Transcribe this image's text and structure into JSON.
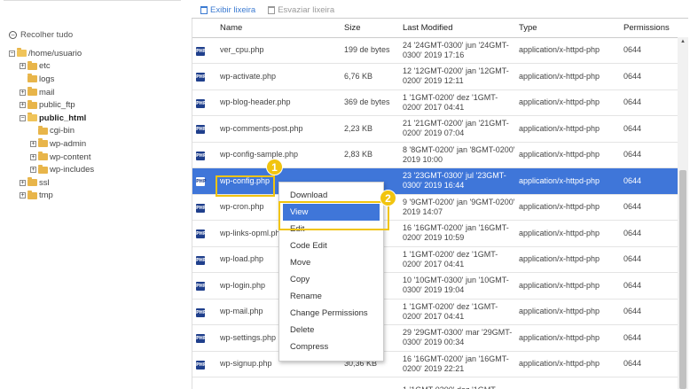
{
  "sidebar": {
    "collapse_label": "Recolher tudo",
    "tree": {
      "root": "/home/usuario",
      "etc": "etc",
      "logs": "logs",
      "mail": "mail",
      "public_ftp": "public_ftp",
      "public_html": "public_html",
      "cgi_bin": "cgi-bin",
      "wp_admin": "wp-admin",
      "wp_content": "wp-content",
      "wp_includes": "wp-includes",
      "ssl": "ssl",
      "tmp": "tmp"
    }
  },
  "toolbar": {
    "show_trash": "Exibir lixeira",
    "empty_trash": "Esvaziar lixeira"
  },
  "table": {
    "headers": {
      "name": "Name",
      "size": "Size",
      "modified": "Last Modified",
      "type": "Type",
      "permissions": "Permissions"
    },
    "rows": [
      {
        "name": "ver_cpu.php",
        "size": "199 de bytes",
        "modified": "24 '24GMT-0300' jun '24GMT-0300' 2019 17:16",
        "type": "application/x-httpd-php",
        "perm": "0644"
      },
      {
        "name": "wp-activate.php",
        "size": "6,76 KB",
        "modified": "12 '12GMT-0200' jan '12GMT-0200' 2019 12:11",
        "type": "application/x-httpd-php",
        "perm": "0644"
      },
      {
        "name": "wp-blog-header.php",
        "size": "369 de bytes",
        "modified": "1 '1GMT-0200' dez '1GMT-0200' 2017 04:41",
        "type": "application/x-httpd-php",
        "perm": "0644"
      },
      {
        "name": "wp-comments-post.php",
        "size": "2,23 KB",
        "modified": "21 '21GMT-0200' jan '21GMT-0200' 2019 07:04",
        "type": "application/x-httpd-php",
        "perm": "0644"
      },
      {
        "name": "wp-config-sample.php",
        "size": "2,83 KB",
        "modified": "8 '8GMT-0200' jan '8GMT-0200' 2019 10:00",
        "type": "application/x-httpd-php",
        "perm": "0644"
      },
      {
        "name": "wp-config.php",
        "size": "",
        "modified": "23 '23GMT-0300' jul '23GMT-0300' 2019 16:44",
        "type": "application/x-httpd-php",
        "perm": "0644"
      },
      {
        "name": "wp-cron.php",
        "size": "",
        "modified": "9 '9GMT-0200' jan '9GMT-0200' 2019 14:07",
        "type": "application/x-httpd-php",
        "perm": "0644"
      },
      {
        "name": "wp-links-opml.php",
        "size": "",
        "modified": "16 '16GMT-0200' jan '16GMT-0200' 2019 10:59",
        "type": "application/x-httpd-php",
        "perm": "0644"
      },
      {
        "name": "wp-load.php",
        "size": "",
        "modified": "1 '1GMT-0200' dez '1GMT-0200' 2017 04:41",
        "type": "application/x-httpd-php",
        "perm": "0644"
      },
      {
        "name": "wp-login.php",
        "size": "",
        "modified": "10 '10GMT-0300' jun '10GMT-0300' 2019 19:04",
        "type": "application/x-httpd-php",
        "perm": "0644"
      },
      {
        "name": "wp-mail.php",
        "size": "",
        "modified": "1 '1GMT-0200' dez '1GMT-0200' 2017 04:41",
        "type": "application/x-httpd-php",
        "perm": "0644"
      },
      {
        "name": "wp-settings.php",
        "size": "",
        "modified": "29 '29GMT-0300' mar '29GMT-0300' 2019 00:34",
        "type": "application/x-httpd-php",
        "perm": "0644"
      },
      {
        "name": "wp-signup.php",
        "size": "30,36 KB",
        "modified": "16 '16GMT-0200' jan '16GMT-0200' 2019 22:21",
        "type": "application/x-httpd-php",
        "perm": "0644"
      },
      {
        "name": "",
        "size": "",
        "modified": "1 '1GMT-0200' dez '1GMT-",
        "type": "",
        "perm": ""
      }
    ]
  },
  "context_menu": {
    "items": [
      "Download",
      "View",
      "Edit",
      "Code Edit",
      "Move",
      "Copy",
      "Rename",
      "Change Permissions",
      "Delete",
      "Compress"
    ]
  },
  "callouts": {
    "one": "1",
    "two": "2"
  },
  "icons": {
    "file": "php-file-icon",
    "folder": "folder-icon",
    "trash": "trash-icon"
  },
  "colors": {
    "selected_row": "#3f76d9",
    "callout": "#f1c40f",
    "link": "#3b7ad1"
  }
}
